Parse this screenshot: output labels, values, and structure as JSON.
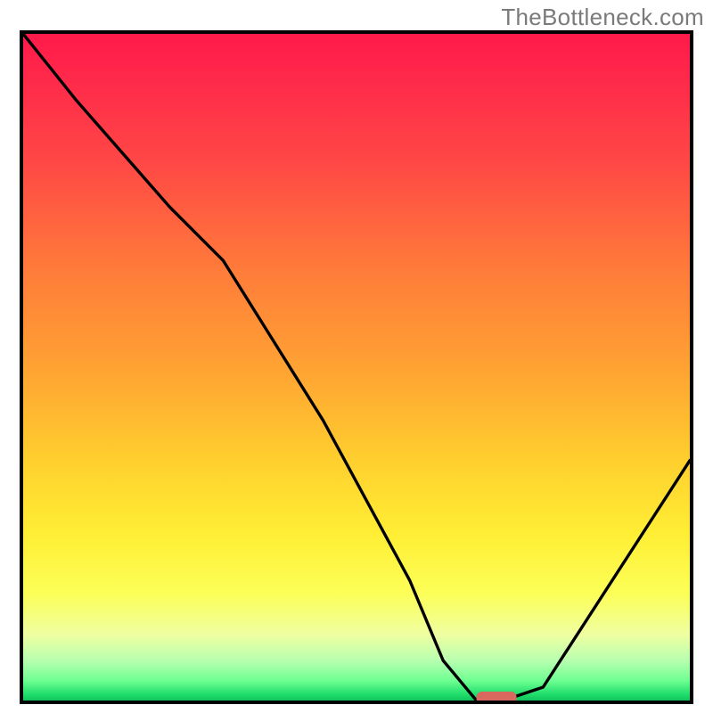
{
  "watermark": "TheBottleneck.com",
  "chart_data": {
    "type": "line",
    "title": "",
    "xlabel": "",
    "ylabel": "",
    "xlim": [
      0,
      100
    ],
    "ylim": [
      0,
      100
    ],
    "series": [
      {
        "name": "bottleneck-curve",
        "x": [
          0,
          8,
          22,
          30,
          45,
          58,
          63,
          68,
          72,
          78,
          100
        ],
        "y": [
          100,
          90,
          74,
          66,
          42,
          18,
          6,
          0,
          0,
          2,
          36
        ]
      }
    ],
    "marker": {
      "name": "optimal-point",
      "x_start": 68,
      "x_end": 74,
      "y": 0,
      "color": "#d9685f"
    },
    "background_gradient": {
      "top": "#ff1a4a",
      "mid": "#ffcf2e",
      "bottom": "#10c45a"
    }
  }
}
